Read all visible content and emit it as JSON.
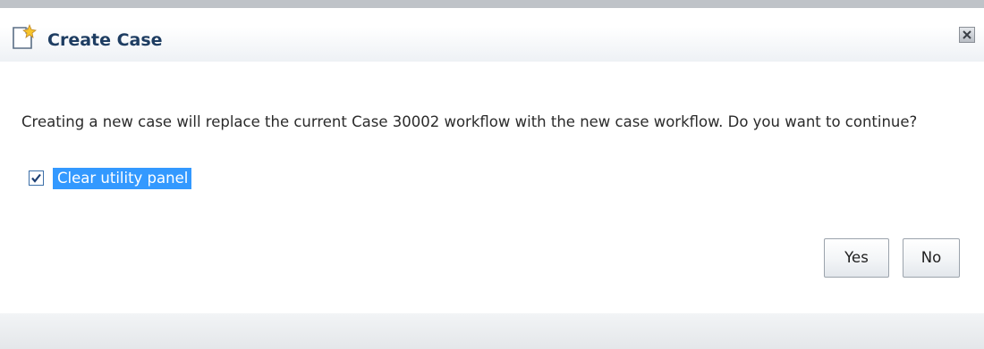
{
  "dialog": {
    "title": "Create Case",
    "title_icon": "new-document-sparkle-icon",
    "close_icon": "close-icon",
    "message": "Creating a new case will replace the current Case 30002 workflow with the new case workflow. Do you want to continue?",
    "checkbox": {
      "label": "Clear utility panel",
      "checked": true
    },
    "buttons": {
      "yes_label": "Yes",
      "no_label": "No"
    }
  },
  "colors": {
    "title_text": "#1e3d62",
    "selection_highlight": "#3399ff",
    "checkbox_border": "#3c6fa8"
  }
}
